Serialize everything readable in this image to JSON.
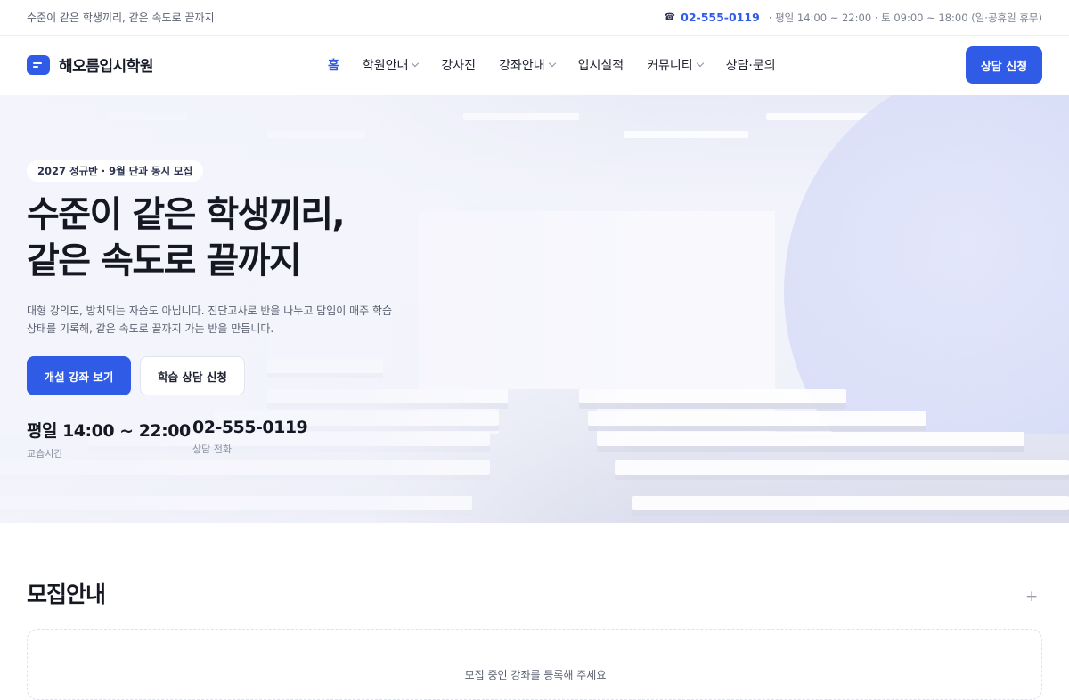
{
  "topbar": {
    "tagline": "수준이 같은 학생끼리, 같은 속도로 끝까지",
    "phone": "02-555-0119",
    "hours": "· 평일 14:00 ~ 22:00 · 토 09:00 ~ 18:00 (일·공휴일 휴무)"
  },
  "header": {
    "logo_text": "해오름입시학원",
    "nav": [
      {
        "label": "홈"
      },
      {
        "label": "학원안내"
      },
      {
        "label": "강사진"
      },
      {
        "label": "강좌안내"
      },
      {
        "label": "입시실적"
      },
      {
        "label": "커뮤니티"
      },
      {
        "label": "상담·문의"
      }
    ],
    "cta_label": "상담 신청"
  },
  "hero": {
    "badge": "2027 정규반 · 9월 단과 동시 모집",
    "headline_line1": "수준이 같은 학생끼리,",
    "headline_line2": "같은 속도로 끝까지",
    "description_line1": "대형 강의도, 방치되는 자습도 아닙니다. 진단고사로 반을 나누고 담임이 매주 학습",
    "description_line2": "상태를 기록해, 같은 속도로 끝까지 가는 반을 만듭니다.",
    "primary_button": "개설 강좌 보기",
    "secondary_button": "학습 상담 신청",
    "stats": [
      {
        "value": "평일 14:00 ~ 22:00",
        "label": "교습시간"
      },
      {
        "value": "02-555-0119",
        "label": "상담 전화"
      }
    ]
  },
  "recruit": {
    "title": "모집안내",
    "card_text": "모집 중인 강좌를 등록해 주세요"
  },
  "colors": {
    "accent": "#2f5be6",
    "text_dark": "#151822",
    "text_muted": "#5a6070"
  },
  "icons": {
    "phone": "phone-icon",
    "logo": "menu-logo-icon",
    "chevron": "chevron-down-icon",
    "plus": "plus-icon"
  }
}
